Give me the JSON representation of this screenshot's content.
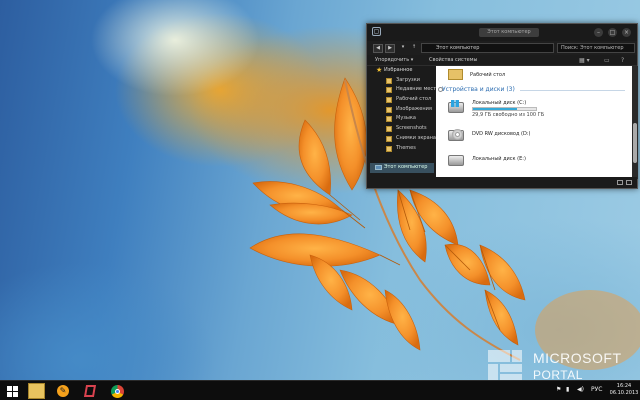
{
  "window": {
    "title": "Этот компьютер",
    "address": "Этот компьютер",
    "search_placeholder": "Поиск: Этот компьютер",
    "commands": {
      "organize": "Упорядочить ▾",
      "system_properties": "Свойства системы"
    }
  },
  "nav": {
    "favorites_label": "Избранное",
    "items": [
      {
        "label": "Загрузки"
      },
      {
        "label": "Недавние места"
      },
      {
        "label": "Рабочий стол"
      },
      {
        "label": "Изображения"
      },
      {
        "label": "Музыка"
      },
      {
        "label": "Screenshots"
      },
      {
        "label": "Снимки экрана"
      },
      {
        "label": "Themes"
      }
    ],
    "selected_label": "Этот компьютер"
  },
  "content": {
    "desktop_item": "Рабочий стол",
    "group_header": "Устройства и диски (3)",
    "drives": [
      {
        "name": "Локальный диск (C:)",
        "free_text": "29,9 ГБ свободно из 100 ГБ",
        "used_fraction": 0.7,
        "icon": "windows-drive-icon"
      },
      {
        "name": "DVD RW дисковод (D:)",
        "icon": "dvd-drive-icon"
      },
      {
        "name": "Локальный диск (E:)",
        "icon": "hard-drive-icon"
      }
    ]
  },
  "taskbar": {
    "apps": [
      "start-icon",
      "file-explorer-icon",
      "app-orange-icon",
      "app-red-icon",
      "chrome-icon"
    ],
    "lang": "РУС",
    "time": "16:24",
    "date": "06.10.2013"
  },
  "watermark": {
    "line1": "MICROSOFT",
    "line2": "PORTAL"
  },
  "colors": {
    "accent": "#35a8d6",
    "taskbar": "#0d0d0d",
    "window": "#1c1c1c",
    "leaf": "#f08a1f"
  }
}
